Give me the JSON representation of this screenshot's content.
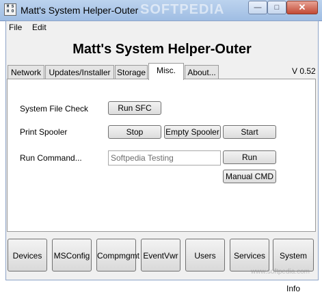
{
  "window": {
    "title": "Matt's System Helper-Outer",
    "watermark": "SOFTPEDIA",
    "min_glyph": "—",
    "max_glyph": "□",
    "close_glyph": "✕",
    "icon_letters": [
      "M",
      "S",
      "H",
      "O"
    ]
  },
  "menu": {
    "file": "File",
    "edit": "Edit"
  },
  "header": {
    "title": "Matt's System Helper-Outer",
    "version": "V 0.52"
  },
  "tabs": [
    "Network",
    "Updates/Installer",
    "Storage",
    "Misc.",
    "About..."
  ],
  "misc": {
    "sfc_label": "System File Check",
    "sfc_button": "Run SFC",
    "spooler_label": "Print Spooler",
    "stop_button": "Stop",
    "empty_button": "Empty Spooler",
    "start_button": "Start",
    "cmd_label": "Run Command...",
    "cmd_value": "Softpedia Testing",
    "run_button": "Run",
    "manual_button": "Manual CMD"
  },
  "bottom_buttons": [
    "Devices",
    "MSConfig",
    "Compmgmt",
    "EventVwr",
    "Users",
    "Services",
    "System Info"
  ],
  "bottom_watermark": "www.softpedia.com"
}
